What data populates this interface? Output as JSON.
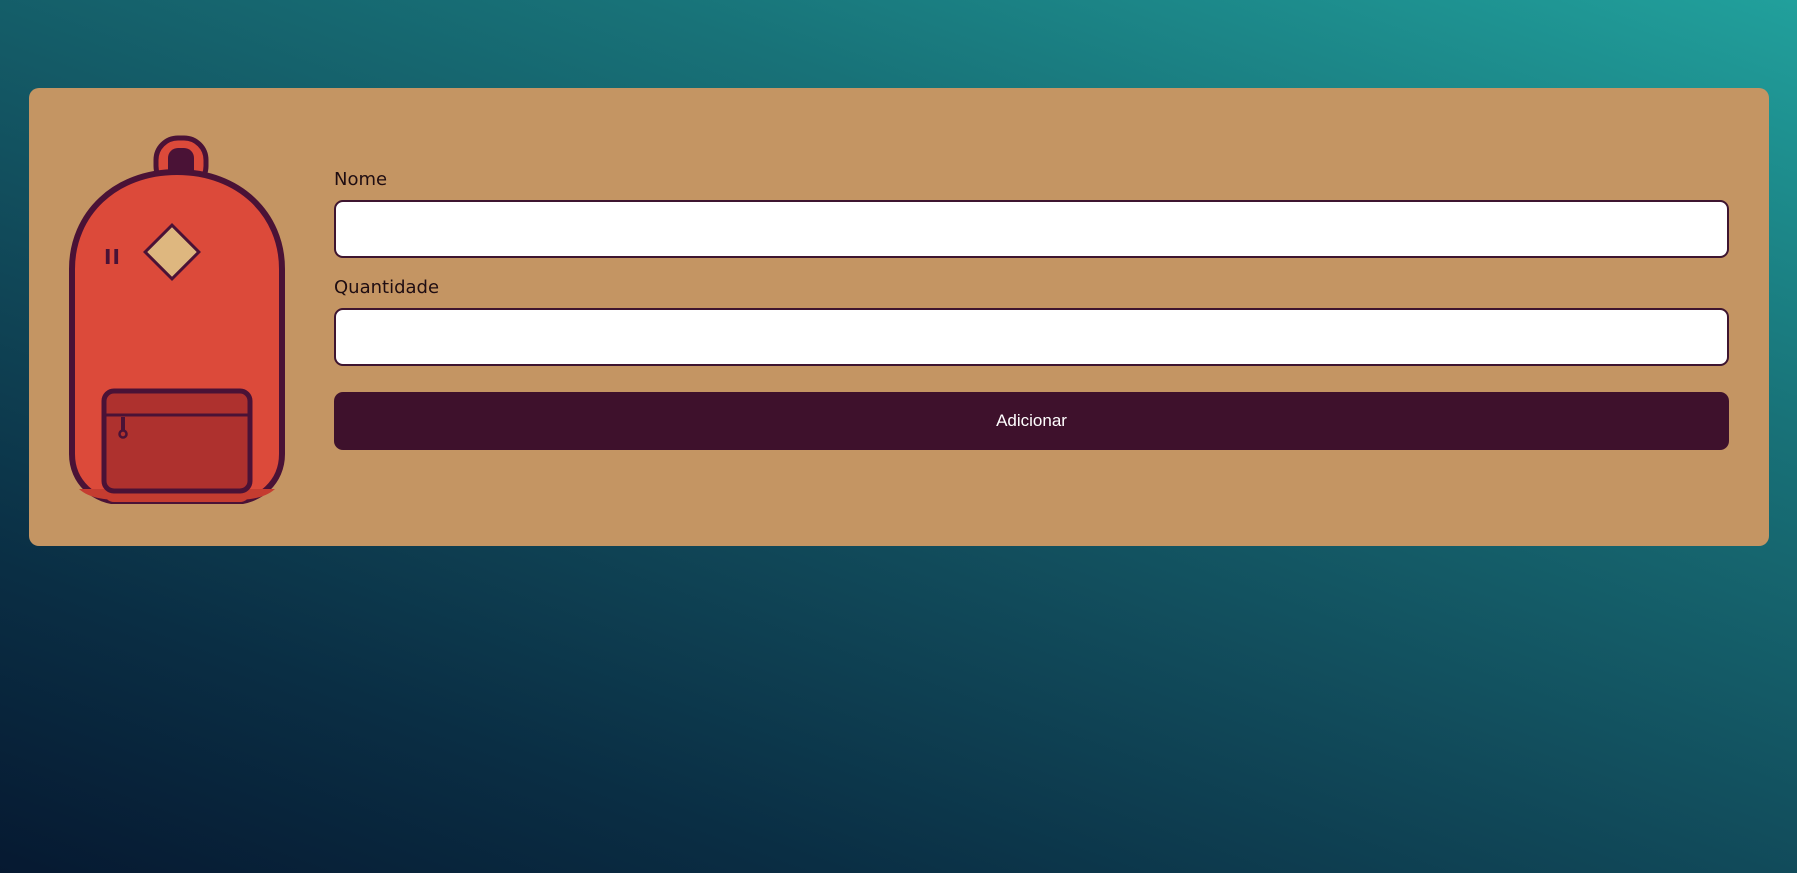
{
  "form": {
    "name_label": "Nome",
    "name_value": "",
    "quantity_label": "Quantidade",
    "quantity_value": "",
    "submit_label": "Adicionar"
  },
  "illustration": {
    "icon": "backpack-icon",
    "badge_text": "II"
  },
  "colors": {
    "background_gradient": [
      "#21a09c",
      "#187278",
      "#114a5a",
      "#0a2e44",
      "#061931"
    ],
    "card": "#c49563",
    "button": "#3e112c",
    "button_text": "#ffffff",
    "input_border": "#3e1530",
    "backpack_body": "#dc4a3a",
    "backpack_outline": "#4a1236",
    "backpack_pocket": "#ae312e",
    "backpack_patch": "#deb77f"
  }
}
